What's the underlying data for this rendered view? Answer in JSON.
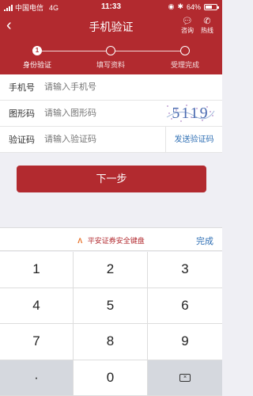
{
  "status_bar": {
    "carrier": "中国电信",
    "network": "4G",
    "time": "11:33",
    "battery": "64%",
    "battery_level": 0.64
  },
  "nav": {
    "back_icon": "chevron-left-icon",
    "title": "手机验证",
    "consult_label": "咨询",
    "hotline_label": "热线"
  },
  "steps": [
    {
      "num": "1",
      "label": "身份验证",
      "active": true
    },
    {
      "num": "",
      "label": "填写资料",
      "active": false
    },
    {
      "num": "",
      "label": "受理完成",
      "active": false
    }
  ],
  "form": {
    "phone": {
      "label": "手机号",
      "placeholder": "请输入手机号"
    },
    "captcha": {
      "label": "图形码",
      "placeholder": "请输入图形码",
      "image_text": "5119"
    },
    "code": {
      "label": "验证码",
      "placeholder": "请输入验证码",
      "send_label": "发送验证码"
    }
  },
  "next_button": "下一步",
  "keyboard": {
    "brand": "平安证券安全键盘",
    "done": "完成",
    "keys": [
      "1",
      "2",
      "3",
      "4",
      "5",
      "6",
      "7",
      "8",
      "9",
      "·",
      "0",
      ""
    ]
  },
  "colors": {
    "brand_red": "#b22a2f",
    "link_blue": "#2f6fb4"
  }
}
